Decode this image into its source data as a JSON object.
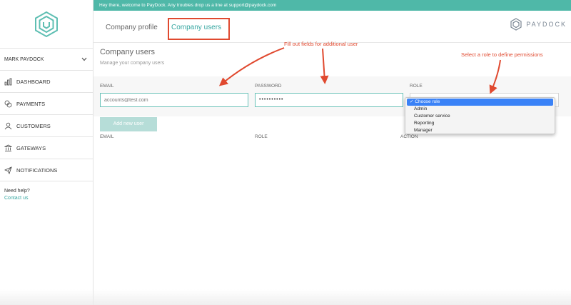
{
  "banner": {
    "text": "Hey there, welcome to PayDock. Any troubles drop us a line at support@paydock.com"
  },
  "sidebar": {
    "user_name": "MARK PAYDOCK",
    "items": [
      {
        "label": "DASHBOARD",
        "icon": "bar-chart-icon"
      },
      {
        "label": "PAYMENTS",
        "icon": "coins-icon"
      },
      {
        "label": "CUSTOMERS",
        "icon": "users-icon"
      },
      {
        "label": "GATEWAYS",
        "icon": "bank-icon"
      },
      {
        "label": "NOTIFICATIONS",
        "icon": "paper-plane-icon"
      }
    ],
    "help_text": "Need help?",
    "help_link": "Contact us"
  },
  "tabs": {
    "profile": "Company profile",
    "users": "Company users"
  },
  "brand": {
    "name": "PAYDOCK"
  },
  "page": {
    "title": "Company users",
    "subtitle": "Manage your company users"
  },
  "form": {
    "email_label": "EMAIL",
    "password_label": "PASSWORD",
    "role_label": "ROLE",
    "email_placeholder": "accounts@test.com",
    "password_value": "••••••••••",
    "add_button": "Add new user"
  },
  "role_options": [
    "Choose role",
    "Admin",
    "Customer service",
    "Reporting",
    "Manager"
  ],
  "role_selected_mark": "✓",
  "table_headers": {
    "email": "EMAIL",
    "role": "ROLE",
    "action": "ACTION"
  },
  "annotations": {
    "fill_fields": "Fill out fields for additional user",
    "select_role": "Select a role to define permissions"
  },
  "colors": {
    "accent": "#4fb8a8",
    "annotation": "#e0492f",
    "select_highlight": "#3a82f7"
  }
}
